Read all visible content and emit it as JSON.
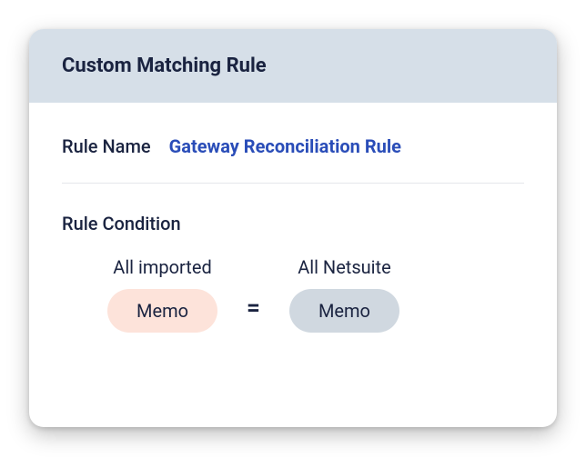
{
  "header": {
    "title": "Custom Matching Rule"
  },
  "ruleName": {
    "label": "Rule Name",
    "value": "Gateway Reconciliation Rule"
  },
  "ruleCondition": {
    "label": "Rule Condition",
    "left": {
      "header": "All imported",
      "pill": "Memo"
    },
    "operator": "=",
    "right": {
      "header": "All Netsuite",
      "pill": "Memo"
    }
  }
}
